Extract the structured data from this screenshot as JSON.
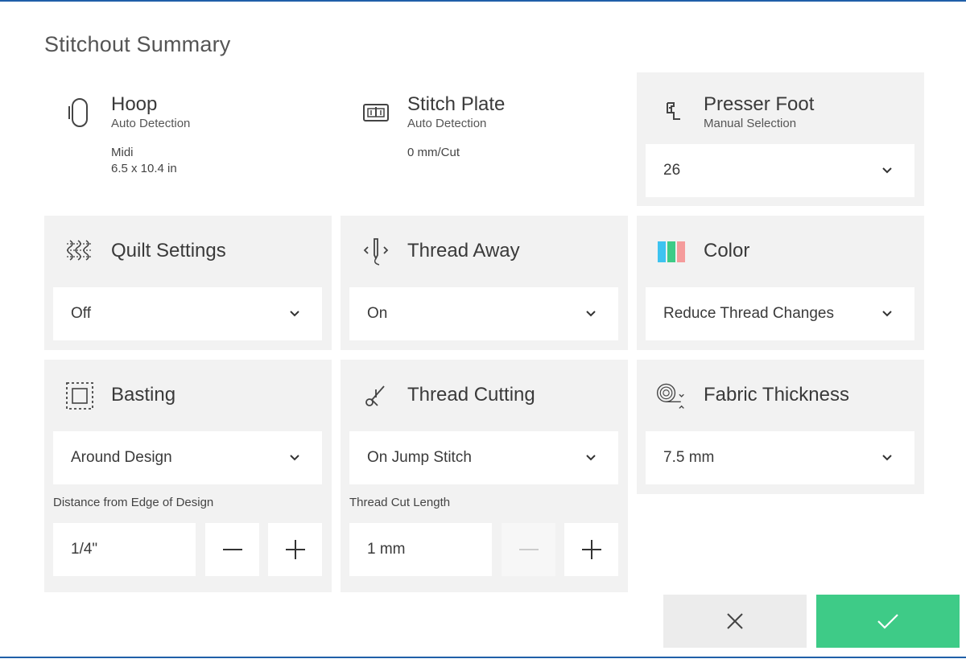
{
  "page": {
    "title": "Stitchout Summary"
  },
  "hoop": {
    "title": "Hoop",
    "subtitle": "Auto Detection",
    "size_name": "Midi",
    "size_dims": "6.5 x 10.4 in",
    "icon": "hoop-icon"
  },
  "stitch_plate": {
    "title": "Stitch Plate",
    "subtitle": "Auto Detection",
    "value": "0 mm/Cut",
    "icon": "stitch-plate-icon"
  },
  "presser_foot": {
    "title": "Presser Foot",
    "subtitle": "Manual Selection",
    "selected": "26",
    "icon": "presser-foot-icon"
  },
  "quilt_settings": {
    "title": "Quilt Settings",
    "selected": "Off",
    "icon": "quilt-icon"
  },
  "thread_away": {
    "title": "Thread Away",
    "selected": "On",
    "icon": "thread-away-icon"
  },
  "color": {
    "title": "Color",
    "selected": "Reduce Thread Changes",
    "icon": "color-bars-icon",
    "bar_colors": [
      "#3ec3f0",
      "#3ecb87",
      "#f59b9b"
    ]
  },
  "basting": {
    "title": "Basting",
    "selected": "Around Design",
    "distance_label": "Distance from Edge of Design",
    "distance_value": "1/4\"",
    "icon": "basting-icon"
  },
  "thread_cutting": {
    "title": "Thread Cutting",
    "selected": "On Jump Stitch",
    "length_label": "Thread Cut Length",
    "length_value": "1 mm",
    "icon": "scissors-icon"
  },
  "fabric_thickness": {
    "title": "Fabric Thickness",
    "selected": "7.5 mm",
    "icon": "fabric-roll-icon"
  },
  "actions": {
    "cancel_icon": "close-icon",
    "confirm_icon": "check-icon"
  },
  "colors": {
    "accent_green": "#3ecb87",
    "border_blue": "#1f5fa8",
    "card_gray": "#f2f2f2"
  }
}
